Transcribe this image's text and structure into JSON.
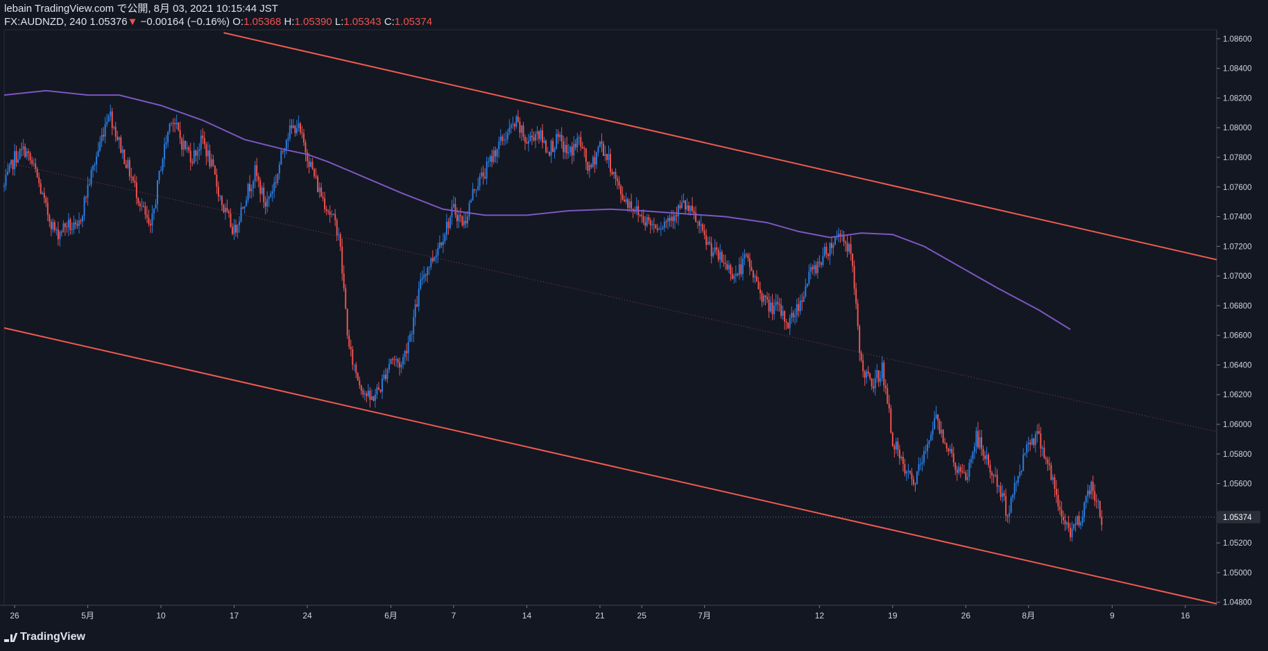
{
  "header": {
    "published_by": "lebain TradingView.com で公開, 8月 03, 2021 10:15:44 JST",
    "symbol": "FX:AUDNZD, 240",
    "last": "1.05376",
    "change": "−0.00164 (−0.16%)",
    "o_label": "O:",
    "o_value": "1.05368",
    "h_label": "H:",
    "h_value": "1.05390",
    "l_label": "L:",
    "l_value": "1.05343",
    "c_label": "C:",
    "c_value": "1.05374"
  },
  "footer": {
    "brand": "TradingView"
  },
  "colors": {
    "background": "#131722",
    "bullish": "#2a7de1",
    "bearish": "#ef5350",
    "channel": "#f05b50",
    "moving_average": "#7e57c2",
    "axis_text": "#d1d4dc"
  },
  "chart_data": {
    "type": "candlestick",
    "symbol": "FX:AUDNZD",
    "interval": "240",
    "y_axis": {
      "side": "right",
      "ylim": [
        1.0478,
        1.0866
      ],
      "ticks": [
        "1.08600",
        "1.08400",
        "1.08200",
        "1.08000",
        "1.07800",
        "1.07600",
        "1.07400",
        "1.07200",
        "1.07000",
        "1.06800",
        "1.06600",
        "1.06400",
        "1.06200",
        "1.06000",
        "1.05800",
        "1.05600",
        "1.05200",
        "1.05000",
        "1.04800"
      ],
      "price_label": "1.05374"
    },
    "x_axis": {
      "xlim": [
        "2021-04-25",
        "2021-08-19"
      ],
      "ticks": [
        {
          "date": "2021-04-26",
          "label": "26"
        },
        {
          "date": "2021-05-03",
          "label": "5月"
        },
        {
          "date": "2021-05-10",
          "label": "10"
        },
        {
          "date": "2021-05-17",
          "label": "17"
        },
        {
          "date": "2021-05-24",
          "label": "24"
        },
        {
          "date": "2021-06-01",
          "label": "6月"
        },
        {
          "date": "2021-06-07",
          "label": "7"
        },
        {
          "date": "2021-06-14",
          "label": "14"
        },
        {
          "date": "2021-06-21",
          "label": "21"
        },
        {
          "date": "2021-06-25",
          "label": "25"
        },
        {
          "date": "2021-07-01",
          "label": "7月"
        },
        {
          "date": "2021-07-12",
          "label": "12"
        },
        {
          "date": "2021-07-19",
          "label": "19"
        },
        {
          "date": "2021-07-26",
          "label": "26"
        },
        {
          "date": "2021-08-01",
          "label": "8月"
        },
        {
          "date": "2021-08-09",
          "label": "9"
        },
        {
          "date": "2021-08-16",
          "label": "16"
        }
      ]
    },
    "close_path": [
      [
        "2021-04-25",
        1.076
      ],
      [
        "2021-04-26",
        1.078
      ],
      [
        "2021-04-27",
        1.0785
      ],
      [
        "2021-04-28",
        1.077
      ],
      [
        "2021-04-29",
        1.0745
      ],
      [
        "2021-04-30",
        1.0728
      ],
      [
        "2021-05-01",
        1.0735
      ],
      [
        "2021-05-02",
        1.073
      ],
      [
        "2021-05-03",
        1.076
      ],
      [
        "2021-05-04",
        1.0785
      ],
      [
        "2021-05-05",
        1.0812
      ],
      [
        "2021-05-06",
        1.079
      ],
      [
        "2021-05-07",
        1.077
      ],
      [
        "2021-05-08",
        1.075
      ],
      [
        "2021-05-09",
        1.073
      ],
      [
        "2021-05-10",
        1.0775
      ],
      [
        "2021-05-11",
        1.0808
      ],
      [
        "2021-05-12",
        1.079
      ],
      [
        "2021-05-13",
        1.078
      ],
      [
        "2021-05-14",
        1.0792
      ],
      [
        "2021-05-15",
        1.077
      ],
      [
        "2021-05-16",
        1.0745
      ],
      [
        "2021-05-17",
        1.073
      ],
      [
        "2021-05-18",
        1.0752
      ],
      [
        "2021-05-19",
        1.077
      ],
      [
        "2021-05-20",
        1.0748
      ],
      [
        "2021-05-21",
        1.0765
      ],
      [
        "2021-05-22",
        1.0795
      ],
      [
        "2021-05-23",
        1.0802
      ],
      [
        "2021-05-24",
        1.0782
      ],
      [
        "2021-05-25",
        1.076
      ],
      [
        "2021-05-26",
        1.0745
      ],
      [
        "2021-05-27",
        1.073
      ],
      [
        "2021-05-28",
        1.065
      ],
      [
        "2021-05-29",
        1.0628
      ],
      [
        "2021-05-30",
        1.0616
      ],
      [
        "2021-05-31",
        1.0625
      ],
      [
        "2021-06-01",
        1.0645
      ],
      [
        "2021-06-02",
        1.064
      ],
      [
        "2021-06-03",
        1.0665
      ],
      [
        "2021-06-04",
        1.07
      ],
      [
        "2021-06-05",
        1.0712
      ],
      [
        "2021-06-06",
        1.0728
      ],
      [
        "2021-06-07",
        1.0745
      ],
      [
        "2021-06-08",
        1.0735
      ],
      [
        "2021-06-09",
        1.076
      ],
      [
        "2021-06-10",
        1.077
      ],
      [
        "2021-06-11",
        1.0785
      ],
      [
        "2021-06-12",
        1.0795
      ],
      [
        "2021-06-13",
        1.0803
      ],
      [
        "2021-06-14",
        1.079
      ],
      [
        "2021-06-15",
        1.0798
      ],
      [
        "2021-06-16",
        1.0785
      ],
      [
        "2021-06-17",
        1.0792
      ],
      [
        "2021-06-18",
        1.0782
      ],
      [
        "2021-06-19",
        1.0792
      ],
      [
        "2021-06-20",
        1.077
      ],
      [
        "2021-06-21",
        1.079
      ],
      [
        "2021-06-22",
        1.0775
      ],
      [
        "2021-06-23",
        1.0755
      ],
      [
        "2021-06-24",
        1.0748
      ],
      [
        "2021-06-25",
        1.074
      ],
      [
        "2021-06-26",
        1.0735
      ],
      [
        "2021-06-27",
        1.0735
      ],
      [
        "2021-06-28",
        1.0742
      ],
      [
        "2021-06-29",
        1.0748
      ],
      [
        "2021-06-30",
        1.074
      ],
      [
        "2021-07-01",
        1.0725
      ],
      [
        "2021-07-02",
        1.0715
      ],
      [
        "2021-07-03",
        1.0708
      ],
      [
        "2021-07-04",
        1.07
      ],
      [
        "2021-07-05",
        1.0712
      ],
      [
        "2021-07-06",
        1.0695
      ],
      [
        "2021-07-07",
        1.068
      ],
      [
        "2021-07-08",
        1.0678
      ],
      [
        "2021-07-09",
        1.0668
      ],
      [
        "2021-07-10",
        1.068
      ],
      [
        "2021-07-11",
        1.07
      ],
      [
        "2021-07-12",
        1.071
      ],
      [
        "2021-07-13",
        1.072
      ],
      [
        "2021-07-14",
        1.073
      ],
      [
        "2021-07-15",
        1.0715
      ],
      [
        "2021-07-16",
        1.064
      ],
      [
        "2021-07-17",
        1.0625
      ],
      [
        "2021-07-18",
        1.0638
      ],
      [
        "2021-07-19",
        1.059
      ],
      [
        "2021-07-20",
        1.057
      ],
      [
        "2021-07-21",
        1.056
      ],
      [
        "2021-07-22",
        1.0578
      ],
      [
        "2021-07-23",
        1.0605
      ],
      [
        "2021-07-24",
        1.059
      ],
      [
        "2021-07-25",
        1.0572
      ],
      [
        "2021-07-26",
        1.0562
      ],
      [
        "2021-07-27",
        1.0592
      ],
      [
        "2021-07-28",
        1.0575
      ],
      [
        "2021-07-29",
        1.056
      ],
      [
        "2021-07-30",
        1.054
      ],
      [
        "2021-07-31",
        1.0565
      ],
      [
        "2021-08-01",
        1.059
      ],
      [
        "2021-08-02",
        1.0592
      ],
      [
        "2021-08-03",
        1.057
      ],
      [
        "2021-08-04",
        1.054
      ],
      [
        "2021-08-05",
        1.0528
      ],
      [
        "2021-08-06",
        1.0538
      ],
      [
        "2021-08-07",
        1.056
      ],
      [
        "2021-08-08",
        1.0537
      ]
    ],
    "channel": {
      "upper": [
        [
          "2021-05-16",
          1.0864
        ],
        [
          "2021-08-19",
          1.0711
        ]
      ],
      "lower": [
        [
          "2021-04-25",
          1.0665
        ],
        [
          "2021-08-19",
          1.0479
        ]
      ],
      "mid": [
        [
          "2021-04-25",
          1.0777
        ],
        [
          "2021-08-19",
          1.0595
        ]
      ]
    },
    "moving_average": [
      [
        "2021-04-25",
        1.0822
      ],
      [
        "2021-04-29",
        1.0825
      ],
      [
        "2021-05-03",
        1.0822
      ],
      [
        "2021-05-06",
        1.0822
      ],
      [
        "2021-05-10",
        1.0815
      ],
      [
        "2021-05-14",
        1.0805
      ],
      [
        "2021-05-18",
        1.0792
      ],
      [
        "2021-05-22",
        1.0785
      ],
      [
        "2021-05-24",
        1.0782
      ],
      [
        "2021-05-26",
        1.0777
      ],
      [
        "2021-05-30",
        1.0765
      ],
      [
        "2021-06-02",
        1.0756
      ],
      [
        "2021-06-06",
        1.0745
      ],
      [
        "2021-06-10",
        1.0741
      ],
      [
        "2021-06-14",
        1.0741
      ],
      [
        "2021-06-18",
        1.0744
      ],
      [
        "2021-06-22",
        1.0745
      ],
      [
        "2021-06-25",
        1.0744
      ],
      [
        "2021-06-29",
        1.0742
      ],
      [
        "2021-07-03",
        1.074
      ],
      [
        "2021-07-07",
        1.0736
      ],
      [
        "2021-07-10",
        1.073
      ],
      [
        "2021-07-13",
        1.0726
      ],
      [
        "2021-07-16",
        1.0729
      ],
      [
        "2021-07-19",
        1.0728
      ],
      [
        "2021-07-22",
        1.072
      ],
      [
        "2021-07-25",
        1.0708
      ],
      [
        "2021-07-29",
        1.0692
      ],
      [
        "2021-08-02",
        1.0677
      ],
      [
        "2021-08-05",
        1.0664
      ]
    ]
  }
}
